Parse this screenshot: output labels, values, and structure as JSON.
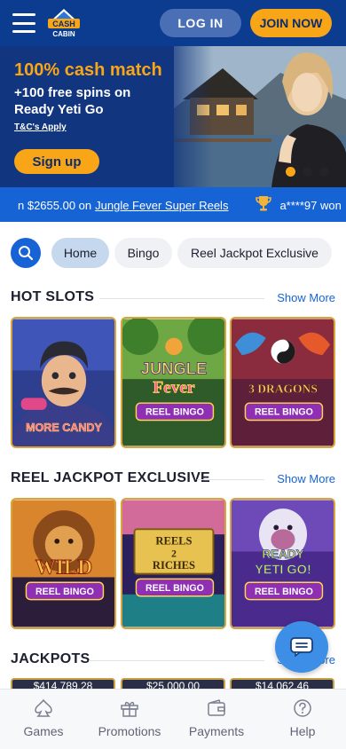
{
  "header": {
    "login_label": "LOG IN",
    "join_label": "JOIN NOW",
    "logo_text_top": "CASH",
    "logo_text_bottom": "CABIN"
  },
  "hero": {
    "title": "100% cash match",
    "subtitle": "+100 free spins on Ready Yeti Go",
    "tc_label": "T&C's Apply",
    "signup_label": "Sign up",
    "slide_count": 3,
    "active_slide": 1
  },
  "ticker": {
    "amount": "n $2655.00 on",
    "game": "Jungle Fever Super Reels",
    "winner": "a****97 won"
  },
  "nav_pills": [
    "Home",
    "Bingo",
    "Reel Jackpot Exclusive"
  ],
  "sections": {
    "hot_slots": {
      "title": "HOT SLOTS",
      "show_more": "Show More",
      "games": [
        "MORE CANDY",
        "JUNGLE FEVER REEL BINGO",
        "3 DRAGONS REEL BINGO"
      ]
    },
    "reel_jackpot": {
      "title": "REEL JACKPOT EXCLUSIVE",
      "show_more": "Show More",
      "games": [
        "WILD LION REEL BINGO",
        "REELS 2 RICHES REEL BINGO",
        "READY YETI GO! REEL BINGO"
      ]
    },
    "jackpots": {
      "title": "JACKPOTS",
      "show_more": "Show More",
      "amounts": [
        "$414,789.28",
        "$25,000.00",
        "$14,062.46"
      ]
    }
  },
  "tile_text": {
    "more_candy": "MORE CANDY",
    "jungle": "JUNGLE",
    "fever": "Fever",
    "reel_bingo": "REEL BINGO",
    "three_dragons": "3 DRAGONS",
    "wild": "WILD",
    "reels": "REELS",
    "two": "2",
    "riches": "RICHES",
    "ready": "READY",
    "yeti_go": "YETI GO!"
  },
  "bottom_nav": {
    "games": "Games",
    "promotions": "Promotions",
    "payments": "Payments",
    "help": "Help"
  },
  "colors": {
    "brand_blue": "#0c3c8f",
    "accent_orange": "#f8a617",
    "link_blue": "#1663d6"
  }
}
